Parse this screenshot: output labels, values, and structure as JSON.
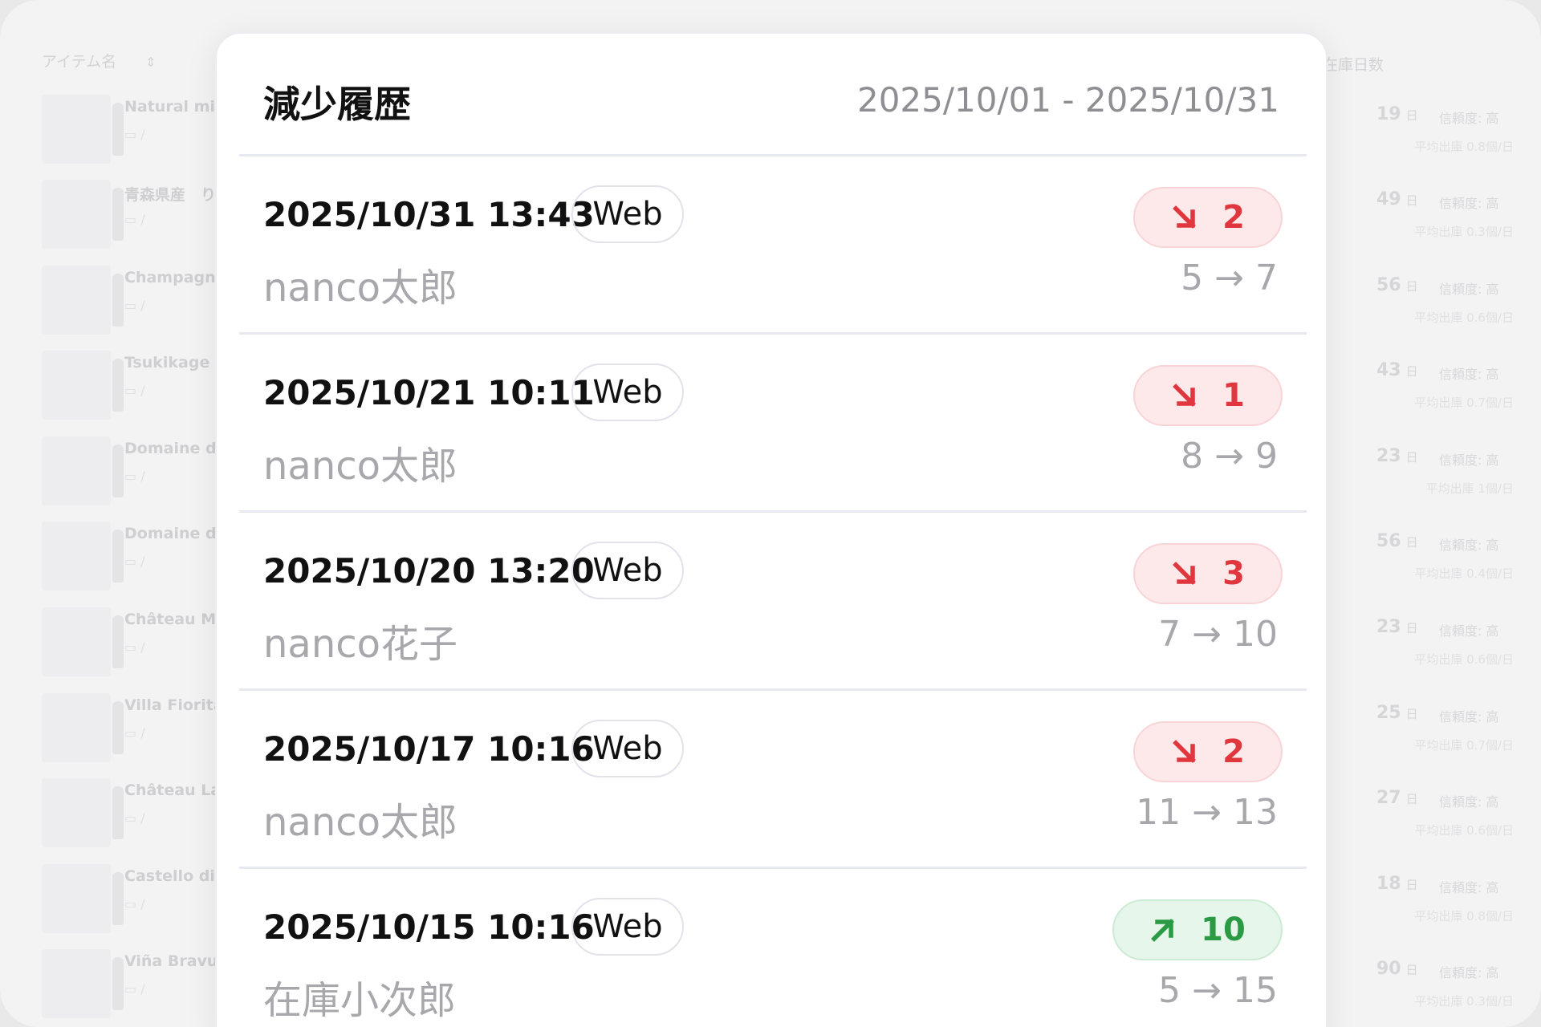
{
  "background": {
    "column_item_name": "アイテム名",
    "column_item_sort": "⇕",
    "column_stock_days": "在庫日数",
    "rows": [
      {
        "name": "Natural mi",
        "days": "19",
        "days_unit": "日",
        "reliability": "信頼度: 高",
        "avg": "平均出庫 0.8個/日"
      },
      {
        "name": "青森県産　り",
        "days": "49",
        "days_unit": "日",
        "reliability": "信頼度: 高",
        "avg": "平均出庫 0.3個/日"
      },
      {
        "name": "Champagne",
        "days": "56",
        "days_unit": "日",
        "reliability": "信頼度: 高",
        "avg": "平均出庫 0.6個/日"
      },
      {
        "name": "Tsukikage",
        "days": "43",
        "days_unit": "日",
        "reliability": "信頼度: 高",
        "avg": "平均出庫 0.7個/日"
      },
      {
        "name": "Domaine d",
        "days": "23",
        "days_unit": "日",
        "reliability": "信頼度: 高",
        "avg": "平均出庫 1個/日"
      },
      {
        "name": "Domaine d",
        "days": "56",
        "days_unit": "日",
        "reliability": "信頼度: 高",
        "avg": "平均出庫 0.4個/日"
      },
      {
        "name": "Château Mo",
        "days": "23",
        "days_unit": "日",
        "reliability": "信頼度: 高",
        "avg": "平均出庫 0.6個/日"
      },
      {
        "name": "Villa Fiorita",
        "days": "25",
        "days_unit": "日",
        "reliability": "信頼度: 高",
        "avg": "平均出庫 0.7個/日"
      },
      {
        "name": "Château La",
        "days": "27",
        "days_unit": "日",
        "reliability": "信頼度: 高",
        "avg": "平均出庫 0.6個/日"
      },
      {
        "name": "Castello di",
        "days": "18",
        "days_unit": "日",
        "reliability": "信頼度: 高",
        "avg": "平均出庫 0.8個/日"
      },
      {
        "name": "Viña Bravur",
        "days": "90",
        "days_unit": "日",
        "reliability": "信頼度: 高",
        "avg": "平均出庫 0.3個/日"
      }
    ],
    "row_meta": "▭ /"
  },
  "modal": {
    "title": "減少履歴",
    "date_range": "2025/10/01 - 2025/10/31",
    "entries": [
      {
        "datetime": "2025/10/31 13:43",
        "source": "Web",
        "user": "nanco太郎",
        "direction": "decrease",
        "amount": "2",
        "change": "5 → 7"
      },
      {
        "datetime": "2025/10/21 10:11",
        "source": "Web",
        "user": "nanco太郎",
        "direction": "decrease",
        "amount": "1",
        "change": "8 → 9"
      },
      {
        "datetime": "2025/10/20 13:20",
        "source": "Web",
        "user": "nanco花子",
        "direction": "decrease",
        "amount": "3",
        "change": "7 → 10"
      },
      {
        "datetime": "2025/10/17 10:16",
        "source": "Web",
        "user": "nanco太郎",
        "direction": "decrease",
        "amount": "2",
        "change": "11 → 13"
      },
      {
        "datetime": "2025/10/15 10:16",
        "source": "Web",
        "user": "在庫小次郎",
        "direction": "increase",
        "amount": "10",
        "change": "5 → 15"
      }
    ]
  },
  "colors": {
    "decrease": "#e0373f",
    "increase": "#2a9a45"
  }
}
